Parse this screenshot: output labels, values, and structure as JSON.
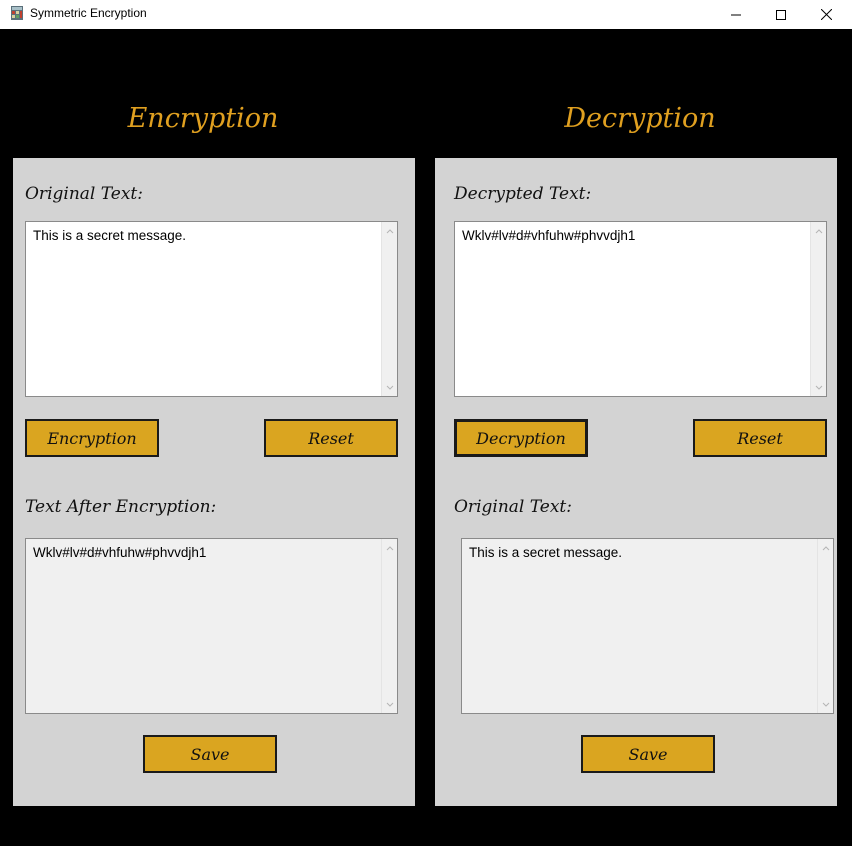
{
  "window": {
    "title": "Symmetric Encryption",
    "minimize_icon": "minimize-icon",
    "maximize_icon": "maximize-icon",
    "close_icon": "close-icon"
  },
  "encryption": {
    "heading": "Encryption",
    "input_label": "Original Text:",
    "input_value": "This is a secret message.",
    "encrypt_button": "Encryption",
    "reset_button": "Reset",
    "output_label": "Text After Encryption:",
    "output_value": "Wklv#lv#d#vhfuhw#phvvdjh1",
    "save_button": "Save"
  },
  "decryption": {
    "heading": "Decryption",
    "input_label": "Decrypted Text:",
    "input_value": "Wklv#lv#d#vhfuhw#phvvdjh1",
    "decrypt_button": "Decryption",
    "reset_button": "Reset",
    "output_label": "Original Text:",
    "output_value": "This is a secret message.",
    "save_button": "Save"
  },
  "colors": {
    "accent": "#daa520",
    "heading": "#e0a020",
    "panel": "#d3d3d3",
    "background": "#000000"
  }
}
